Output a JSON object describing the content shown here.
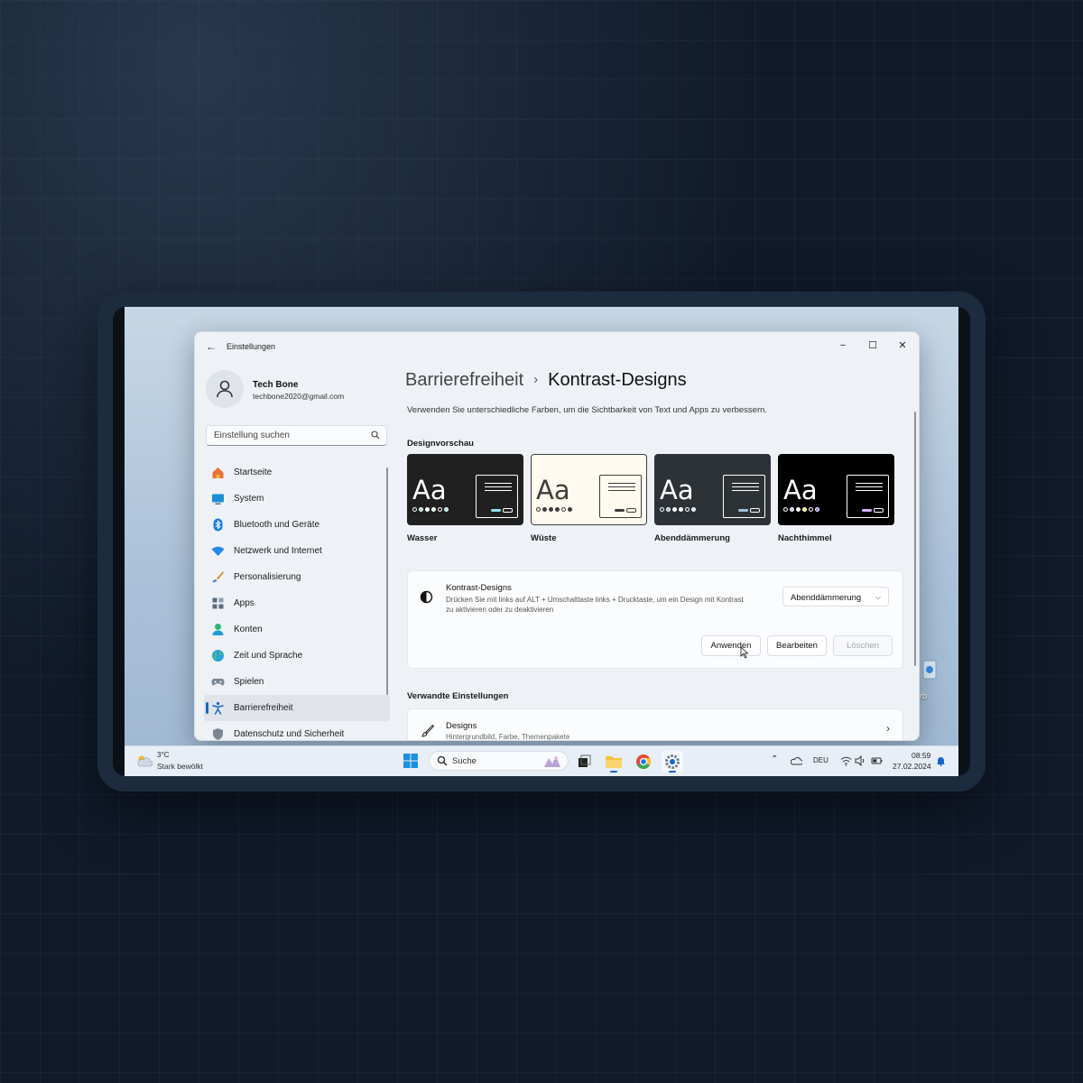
{
  "window": {
    "title": "Einstellungen",
    "controls": {
      "minimize": "−",
      "maximize": "☐",
      "close": "✕"
    }
  },
  "profile": {
    "name": "Tech Bone",
    "email": "techbone2020@gmail.com"
  },
  "search": {
    "placeholder": "Einstellung suchen"
  },
  "sidebar": {
    "items": [
      {
        "label": "Startseite",
        "icon": "home-icon"
      },
      {
        "label": "System",
        "icon": "monitor-icon"
      },
      {
        "label": "Bluetooth und Geräte",
        "icon": "bluetooth-icon"
      },
      {
        "label": "Netzwerk und Internet",
        "icon": "wifi-icon"
      },
      {
        "label": "Personalisierung",
        "icon": "brush-icon"
      },
      {
        "label": "Apps",
        "icon": "apps-icon"
      },
      {
        "label": "Konten",
        "icon": "user-icon"
      },
      {
        "label": "Zeit und Sprache",
        "icon": "globe-icon"
      },
      {
        "label": "Spielen",
        "icon": "gamepad-icon"
      },
      {
        "label": "Barrierefreiheit",
        "icon": "accessibility-icon",
        "active": true
      },
      {
        "label": "Datenschutz und Sicherheit",
        "icon": "shield-icon"
      }
    ]
  },
  "header": {
    "parent": "Barrierefreiheit",
    "separator": "›",
    "current": "Kontrast-Designs",
    "subtitle": "Verwenden Sie unterschiedliche Farben, um die Sichtbarkeit von Text und Apps zu verbessern."
  },
  "preview": {
    "title": "Designvorschau",
    "themes": [
      {
        "name": "Wasser",
        "aa": "Aa",
        "bg": "#202020",
        "fg": "#ffffff",
        "dots": [
          "#202020",
          "#8ee2ec",
          "#ffffff",
          "#ffffff",
          "#202020",
          "#8ee2ec"
        ],
        "accent": "#8ee2ec"
      },
      {
        "name": "Wüste",
        "aa": "Aa",
        "bg": "#fffaef",
        "fg": "#3d3d3d",
        "dots": [
          "#fffaef",
          "#3d3d3d",
          "#3d3d3d",
          "#3d3d3d",
          "#fffaef",
          "#3d3d3d"
        ],
        "accent": "#3d3d3d"
      },
      {
        "name": "Abenddämmerung",
        "aa": "Aa",
        "bg": "#2d3236",
        "fg": "#ffffff",
        "dots": [
          "#2d3236",
          "#a1bfde",
          "#ffffff",
          "#ffffff",
          "#2d3236",
          "#b6f6f0"
        ],
        "accent": "#a1bfde"
      },
      {
        "name": "Nachthimmel",
        "aa": "Aa",
        "bg": "#000000",
        "fg": "#ffffff",
        "dots": [
          "#000000",
          "#d6b4fd",
          "#ffffff",
          "#ffee32",
          "#000000",
          "#8080ff"
        ],
        "accent": "#d6b4fd"
      }
    ]
  },
  "contrast": {
    "title": "Kontrast-Designs",
    "description": "Drücken Sie mit links auf ALT + Umschalttaste links + Drucktaste, um ein Design mit Kontrast zu aktivieren oder zu deaktivieren",
    "selected": "Abenddämmerung",
    "buttons": {
      "apply": "Anwenden",
      "edit": "Bearbeiten",
      "delete": "Löschen"
    }
  },
  "related": {
    "title": "Verwandte Einstellungen",
    "designs": {
      "title": "Designs",
      "subtitle": "Hintergrundbild, Farbe, Themenpakete"
    }
  },
  "taskbar": {
    "weather": {
      "temp": "3°C",
      "desc": "Stark bewölkt"
    },
    "search": "Suche",
    "lang": "DEU",
    "time": "08:59",
    "date": "27.02.2024"
  },
  "desktop": {
    "shortcut_label": "Papierkorb"
  },
  "colors": {
    "accent": "#1467c8",
    "window_bg": "#eef1f6",
    "device": "#1d2b3e",
    "page_bg": "#101a2a"
  }
}
